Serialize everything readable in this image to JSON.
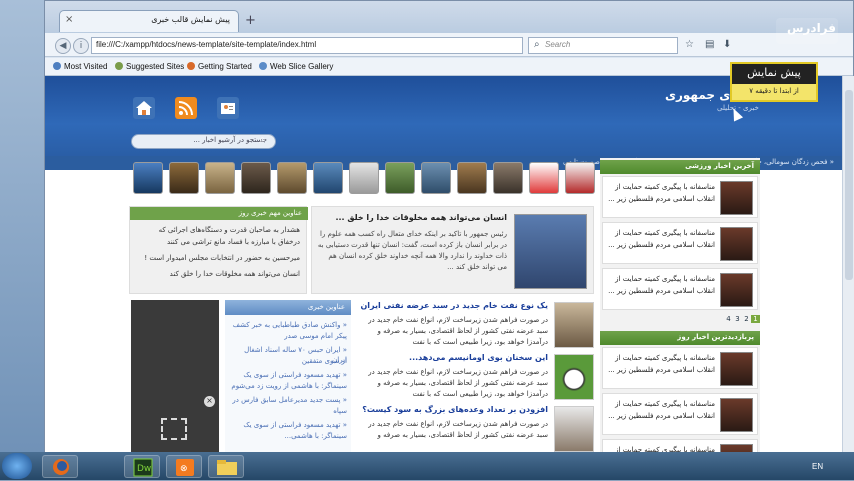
{
  "browser": {
    "tab_title": "پیش نمایش قالب خبری",
    "new_tab": "+",
    "url": "file:///C:/xampp/htdocs/news-template/site-template/index.html",
    "search_placeholder": "Search",
    "bookmarks": [
      "Most Visited",
      "Suggested Sites",
      "Getting Started",
      "Web Slice Gallery"
    ]
  },
  "site": {
    "title": "ی جمهوری",
    "subtitle": "خبری - تحلیلی",
    "search_placeholder": "جستجو در آرشیو اخبار ...",
    "ticker": "« فحص زدگان سومالی، چگونه با لب‌های تشنه نشسته به سجده می‌گذارند ... به صورت تابهی"
  },
  "featured": {
    "title": "انسان می‌تواند همه مخلوقات خدا را خلق ...",
    "body": "رئیس جمهور با تاکید بر اینکه خدای متعال راه کسب همه علوم را در برابر انسان باز کرده است، گفت: انسان تنها قدرت دستیابی به ذات خداوند را ندارد والا همه آنچه خداوند خلق کرده انسان هم می تواند خلق کند ..."
  },
  "important": {
    "header": "عناوین مهم خبری روز",
    "items": [
      "هشدار به صاحبان قدرت و دستگاه‌های اجرائی که",
      "درخفاق با مبارزه با فساد مانع تراشی می کنند",
      "میرحسین به حضور در انتخابات مجلس امیدوار است !",
      "انسان می‌تواند همه مخلوقات خدا را خلق کند"
    ]
  },
  "news": [
    {
      "title": "یک نوع نفت خام جدید در سبد عرضه نفتی ایران",
      "body": "در صورت فراهم شدن زیرساخت لازم، انواع نفت خام جدید در سبد عرضه نفتی کشور از لحاظ اقتصادی، بسیار به صرفه و درآمدزا خواهد بود، زیرا طبیعی است که با نفت"
    },
    {
      "title": "این سخنان بوی اومانیسم می‌دهد...",
      "body": "در صورت فراهم شدن زیرساخت لازم، انواع نفت خام جدید در سبد عرضه نفتی کشور از لحاظ اقتصادی، بسیار به صرفه و درآمدزا خواهد بود، زیرا طبیعی است که با نفت"
    },
    {
      "title": "افزودن بر تعداد وعده‌های بزرگ به سود کیست؟",
      "body": "در صورت فراهم شدن زیرساخت لازم، انواع نفت خام جدید در سبد عرضه نفتی کشور از لحاظ اقتصادی، بسیار به صرفه و"
    }
  ],
  "titles": {
    "header": "عناوین خبری",
    "items": [
      "« واکنش صادق طباطبایی به خبر کشف",
      "پیکر امام موسی صدر",
      "« ایران حبس ۷۰ ساله اسناد اشغال ایران",
      "از سوی متفقین",
      "« تهدید مسعود فراستی از سوی یک",
      "سینماگر: با هاشمی از رویت زد می‌شوم",
      "« پست جدید مدیرعامل سابق فارس در",
      "سپاه",
      "« تهدید مسعود فراستی از سوی یک",
      "سینماگر: با هاشمی..."
    ]
  },
  "sidebar": {
    "header1": "آخرین اخبار ورزشی",
    "header2": "پربازدیدترین اخبار روز",
    "item_text": "مناسفانه با پیگیری کمیته حمایت از انقلاب اسلامی مردم فلسطین زیر ...",
    "pager": [
      "1",
      "2",
      "3",
      "4"
    ]
  },
  "overlay": {
    "logo": "فرادرس",
    "preview_line1": "پیش نمایش",
    "preview_line2": "از ابتدا تا دقیقه ۷"
  },
  "taskbar": {
    "lang": "EN",
    "apps": [
      "Firefox",
      "Dw",
      "XAMPP",
      "Explorer"
    ]
  }
}
